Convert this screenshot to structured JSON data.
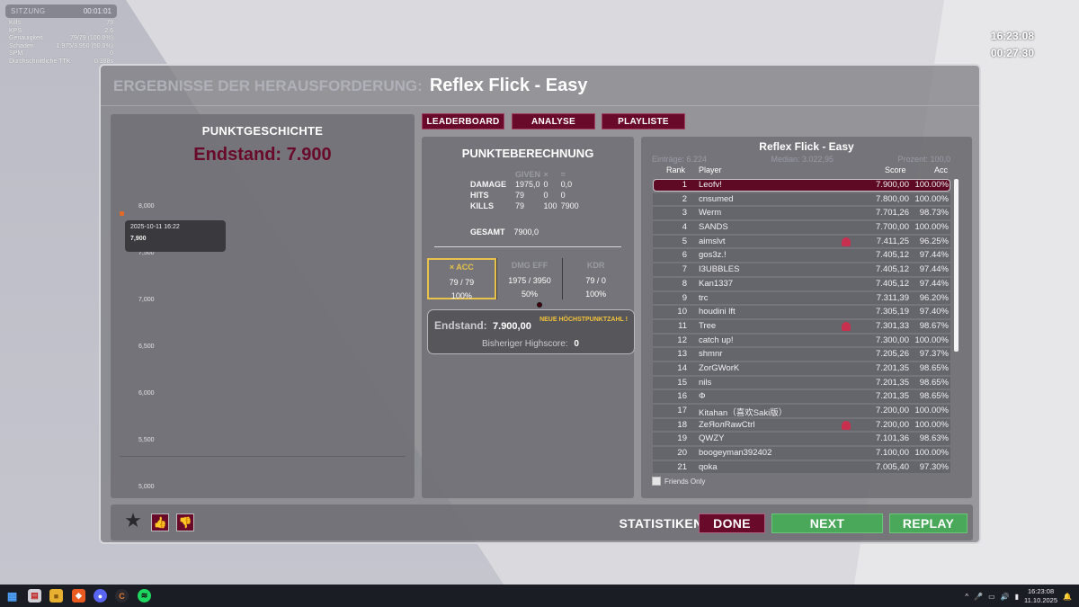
{
  "hud": {
    "title": "SITZUNG",
    "time": "00:01:01",
    "rows": [
      {
        "label": "Kills",
        "value": "79"
      },
      {
        "label": "KPS",
        "value": "2.6"
      },
      {
        "label": "Genauigkeit",
        "value": "79/79 (100.0%)"
      },
      {
        "label": "Schaden",
        "value": "1.975/3.950 (50.0%)"
      },
      {
        "label": "SPM",
        "value": "0"
      },
      {
        "label": "Durchschnittliche TTK",
        "value": "0.388s"
      }
    ]
  },
  "clock_top": "16:23:08",
  "clock_session": "00:27:30",
  "panel": {
    "title_prefix": "ERGEBNISSE DER HERAUSFORDERUNG:",
    "title": "Reflex Flick - Easy"
  },
  "history": {
    "header": "PUNKTGESCHICHTE",
    "final": "Endstand: 7.900",
    "yticks": [
      "8,000",
      "7,500",
      "7,000",
      "6,500",
      "6,000",
      "5,500",
      "5,000"
    ],
    "tooltip_date": "2025-10-11 16:22",
    "tooltip_value": "7,900"
  },
  "tabs": {
    "leaderboard": "LEADERBOARD",
    "analyse": "ANALYSE",
    "playliste": "PLAYLISTE"
  },
  "calc": {
    "header": "PUNKTEBERECHNUNG",
    "columns": [
      "GIVEN",
      "×",
      "="
    ],
    "rows": [
      {
        "label": "DAMAGE",
        "a": "1975,0",
        "b": "0",
        "c": "0,0"
      },
      {
        "label": "HITS",
        "a": "79",
        "b": "0",
        "c": "0"
      },
      {
        "label": "KILLS",
        "a": "79",
        "b": "100",
        "c": "7900"
      }
    ],
    "gesamt_label": "GESAMT",
    "gesamt_value": "7900,0",
    "stats": [
      {
        "head": "× ACC",
        "v1": "79 / 79",
        "v2": "100%"
      },
      {
        "head": "DMG EFF",
        "v1": "1975 / 3950",
        "v2": "50%"
      },
      {
        "head": "KDR",
        "v1": "79 / 0",
        "v2": "100%"
      }
    ],
    "end_label": "Endstand:",
    "end_value": "7.900,00",
    "new_high": "NEUE HÖCHSTPUNKTZAHL !",
    "prev_label": "Bisheriger Highscore:",
    "prev_value": "0"
  },
  "leaderboard": {
    "title": "Reflex Flick - Easy",
    "entries": "Einträge: 6.224",
    "median": "Median: 3.022,95",
    "percent": "Prozent: 100,0",
    "col_rank": "Rank",
    "col_player": "Player",
    "col_score": "Score",
    "col_acc": "Acc",
    "rows": [
      {
        "rank": "1",
        "player": "Leofv!",
        "score": "7.900,00",
        "acc": "100.00%",
        "me": true
      },
      {
        "rank": "2",
        "player": "cnsumed",
        "score": "7.800,00",
        "acc": "100.00%"
      },
      {
        "rank": "3",
        "player": "Werm",
        "score": "7.701,26",
        "acc": "98.73%"
      },
      {
        "rank": "4",
        "player": "SANDS",
        "score": "7.700,00",
        "acc": "100.00%"
      },
      {
        "rank": "5",
        "player": "aimslvt",
        "score": "7.411,25",
        "acc": "96.25%",
        "badge": true
      },
      {
        "rank": "6",
        "player": "gos3z.!",
        "score": "7.405,12",
        "acc": "97.44%"
      },
      {
        "rank": "7",
        "player": "I3UBBLES",
        "score": "7.405,12",
        "acc": "97.44%"
      },
      {
        "rank": "8",
        "player": "Kan1337",
        "score": "7.405,12",
        "acc": "97.44%"
      },
      {
        "rank": "9",
        "player": "trc",
        "score": "7.311,39",
        "acc": "96.20%"
      },
      {
        "rank": "10",
        "player": "houdini lft",
        "score": "7.305,19",
        "acc": "97.40%"
      },
      {
        "rank": "11",
        "player": "Tree",
        "score": "7.301,33",
        "acc": "98.67%",
        "badge": true
      },
      {
        "rank": "12",
        "player": "catch up!",
        "score": "7.300,00",
        "acc": "100.00%"
      },
      {
        "rank": "13",
        "player": "shmnr",
        "score": "7.205,26",
        "acc": "97.37%"
      },
      {
        "rank": "14",
        "player": "ZorGWorK",
        "score": "7.201,35",
        "acc": "98.65%"
      },
      {
        "rank": "15",
        "player": "nils",
        "score": "7.201,35",
        "acc": "98.65%"
      },
      {
        "rank": "16",
        "player": "Φ",
        "score": "7.201,35",
        "acc": "98.65%"
      },
      {
        "rank": "17",
        "player": "Kitahan（喜欢Saki版）",
        "score": "7.200,00",
        "acc": "100.00%"
      },
      {
        "rank": "18",
        "player": "ZeЯoлRawCtrl",
        "score": "7.200,00",
        "acc": "100.00%",
        "badge": true
      },
      {
        "rank": "19",
        "player": "QWZY",
        "score": "7.101,36",
        "acc": "98.63%"
      },
      {
        "rank": "20",
        "player": "boogeyman392402",
        "score": "7.100,00",
        "acc": "100.00%"
      },
      {
        "rank": "21",
        "player": "qoka",
        "score": "7.005,40",
        "acc": "97.30%"
      }
    ],
    "friends_only": "Friends Only"
  },
  "bottom": {
    "statistiken": "STATISTIKEN",
    "done": "DONE",
    "next": "NEXT",
    "replay": "REPLAY"
  },
  "taskbar": {
    "time": "16:23:08",
    "date": "11.10.2025"
  }
}
